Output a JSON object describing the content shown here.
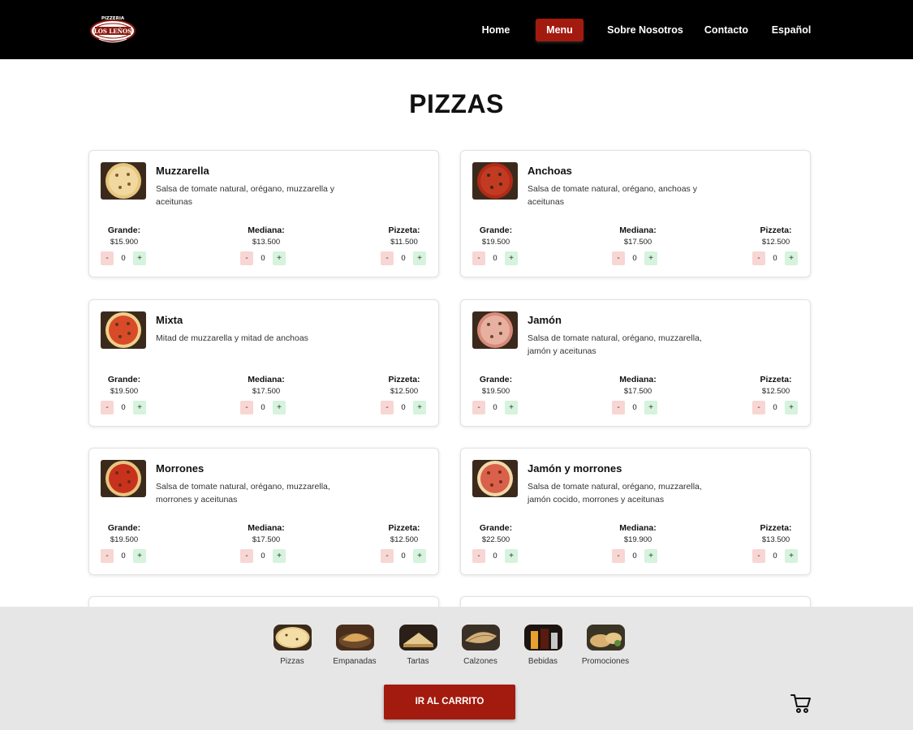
{
  "header": {
    "logo_text": "PIZZERIA LOS LEÑOS",
    "nav": [
      {
        "label": "Home",
        "active": false
      },
      {
        "label": "Menu",
        "active": true
      },
      {
        "label": "Sobre Nosotros",
        "active": false
      },
      {
        "label": "Contacto",
        "active": false
      },
      {
        "label": "Español",
        "active": false
      }
    ]
  },
  "page_title": "PIZZAS",
  "sizes": [
    "Grande:",
    "Mediana:",
    "Pizzeta:"
  ],
  "stepper": {
    "minus": "-",
    "plus": "+"
  },
  "products": [
    {
      "name": "Muzzarella",
      "description": "Salsa de tomate natural, orégano, muzzarella y aceitunas",
      "prices": [
        "$15.900",
        "$13.500",
        "$11.500"
      ],
      "qty": [
        "0",
        "0",
        "0"
      ]
    },
    {
      "name": "Anchoas",
      "description": "Salsa de tomate natural, orégano, anchoas y aceitunas",
      "prices": [
        "$19.500",
        "$17.500",
        "$12.500"
      ],
      "qty": [
        "0",
        "0",
        "0"
      ]
    },
    {
      "name": "Mixta",
      "description": "Mitad de muzzarella y mitad de anchoas",
      "prices": [
        "$19.500",
        "$17.500",
        "$12.500"
      ],
      "qty": [
        "0",
        "0",
        "0"
      ]
    },
    {
      "name": "Jamón",
      "description": "Salsa de tomate natural, orégano, muzzarella, jamón y aceitunas",
      "prices": [
        "$19.500",
        "$17.500",
        "$12.500"
      ],
      "qty": [
        "0",
        "0",
        "0"
      ]
    },
    {
      "name": "Morrones",
      "description": "Salsa de tomate natural, orégano, muzzarella, morrones y aceitunas",
      "prices": [
        "$19.500",
        "$17.500",
        "$12.500"
      ],
      "qty": [
        "0",
        "0",
        "0"
      ]
    },
    {
      "name": "Jamón y morrones",
      "description": "Salsa de tomate natural, orégano, muzzarella, jamón cocido, morrones y aceitunas",
      "prices": [
        "$22.500",
        "$19.900",
        "$13.500"
      ],
      "qty": [
        "0",
        "0",
        "0"
      ]
    }
  ],
  "categories": [
    {
      "label": "Pizzas"
    },
    {
      "label": "Empanadas"
    },
    {
      "label": "Tartas"
    },
    {
      "label": "Calzones"
    },
    {
      "label": "Bebidas"
    },
    {
      "label": "Promociones"
    }
  ],
  "cart_button": "IR AL CARRITO",
  "colors": {
    "accent": "#a31a0e",
    "header_bg": "#000000",
    "bottom_bar_bg": "#e6e6e6",
    "minus_bg": "#f8d6d3",
    "plus_bg": "#d5f3dd"
  }
}
